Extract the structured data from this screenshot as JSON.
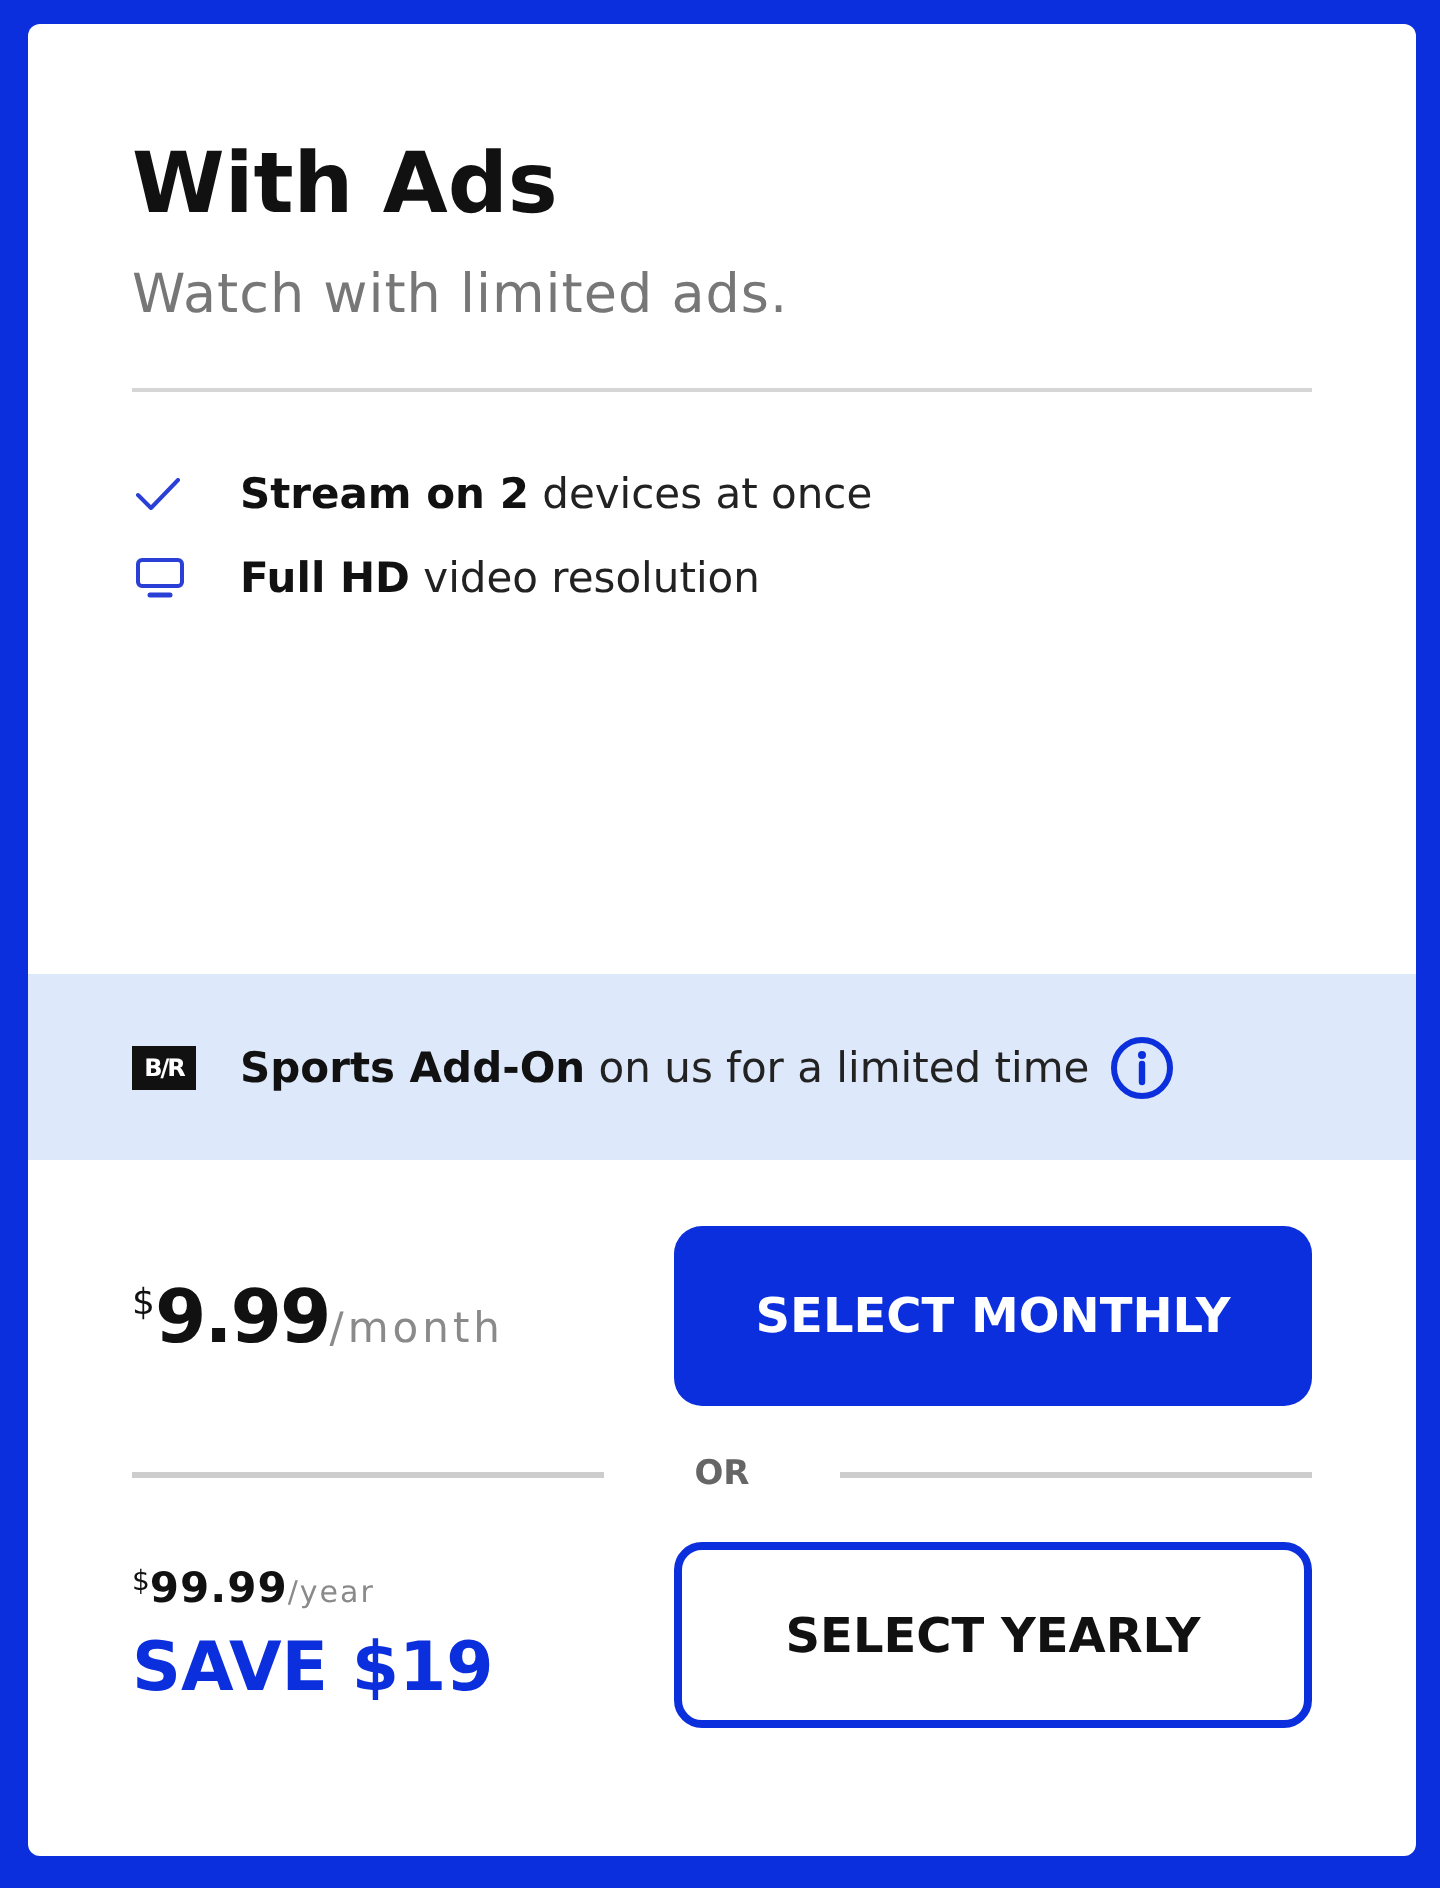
{
  "plan": {
    "title": "With Ads",
    "subtitle": "Watch with limited ads."
  },
  "features": [
    {
      "kind": "check",
      "text": "**Stream on 2** devices at once"
    },
    {
      "kind": "tv",
      "text": "**Full HD** video resolution"
    }
  ],
  "promo": {
    "logo": "B/R",
    "text": "**Sports Add-On** on us for a limited time"
  },
  "pricing": {
    "monthly": {
      "currency": "$",
      "amount": "9.99",
      "period": "/month",
      "button": "SELECT MONTHLY"
    },
    "separator": "OR",
    "yearly": {
      "currency": "$",
      "amount": "99.99",
      "period": "/year",
      "savings": "SAVE $19",
      "button": "SELECT YEARLY"
    }
  }
}
